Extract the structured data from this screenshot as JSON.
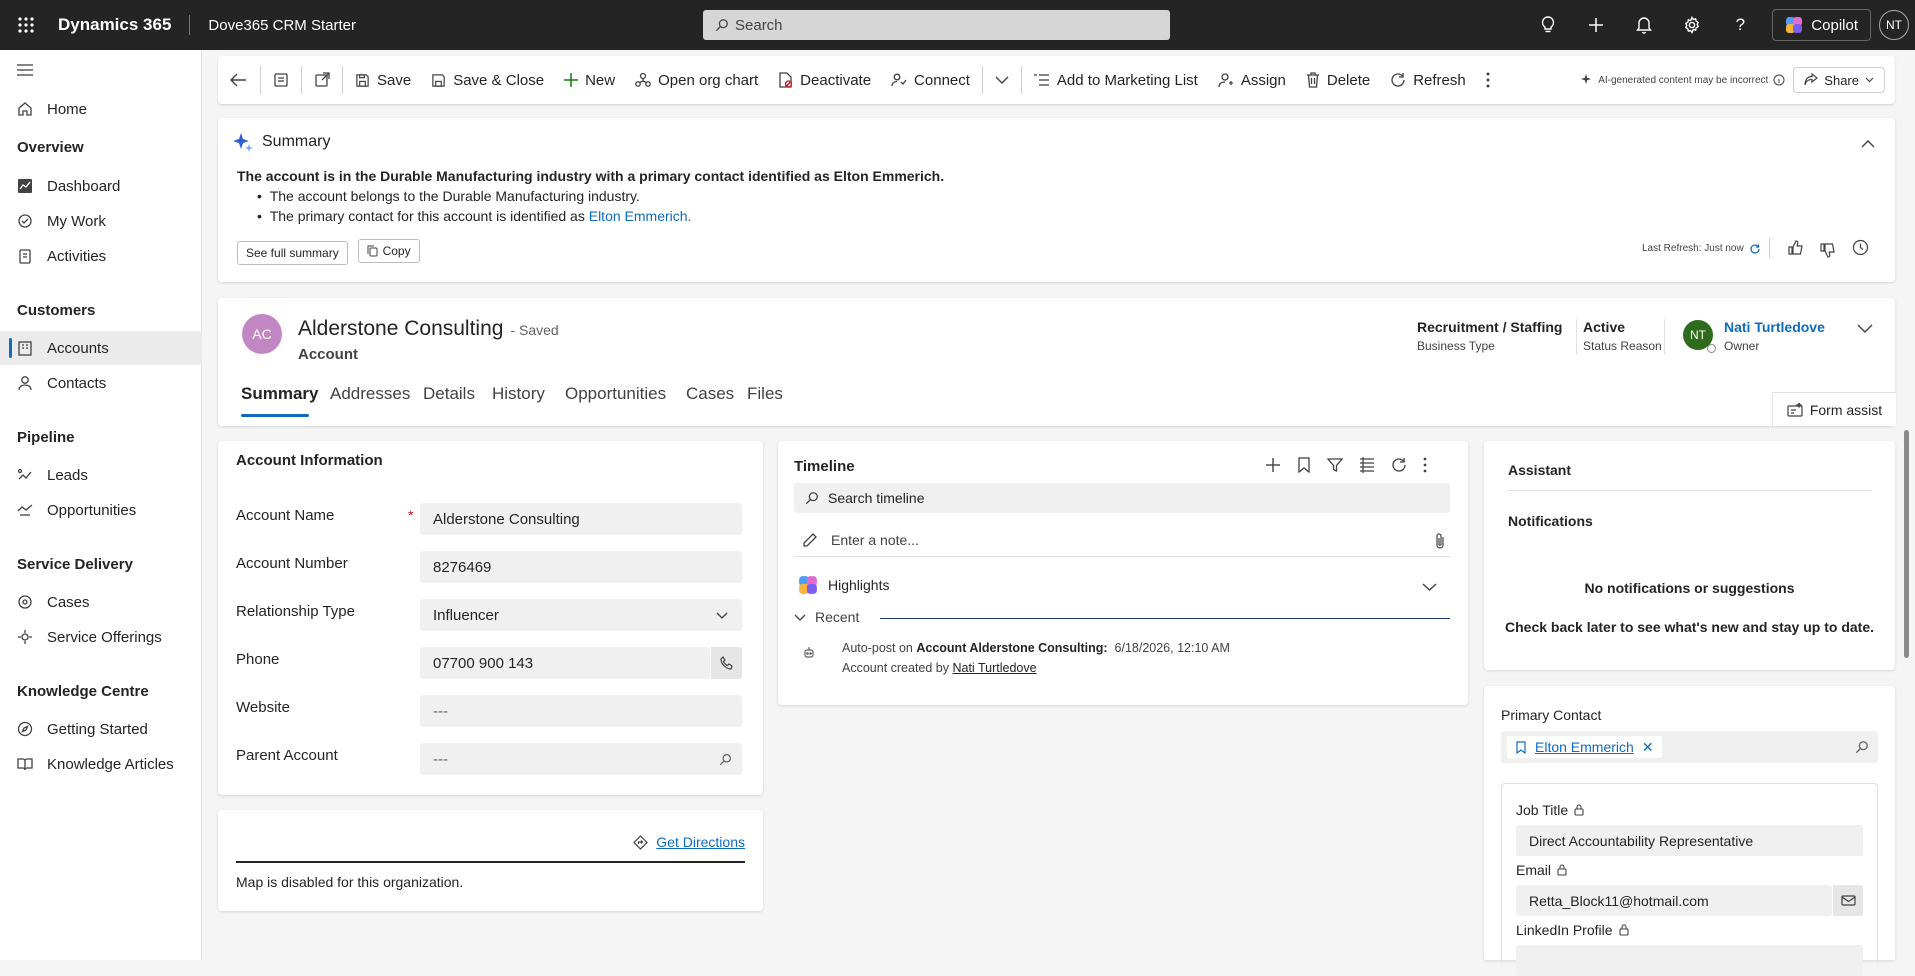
{
  "topbar": {
    "brand": "Dynamics 365",
    "app": "Dove365 CRM Starter",
    "search_placeholder": "Search",
    "copilot": "Copilot",
    "user_initials": "NT"
  },
  "sidebar": {
    "home": "Home",
    "sections": [
      {
        "title": "Overview",
        "items": [
          "Dashboard",
          "My Work",
          "Activities"
        ]
      },
      {
        "title": "Customers",
        "items": [
          "Accounts",
          "Contacts"
        ]
      },
      {
        "title": "Pipeline",
        "items": [
          "Leads",
          "Opportunities"
        ]
      },
      {
        "title": "Service Delivery",
        "items": [
          "Cases",
          "Service Offerings"
        ]
      },
      {
        "title": "Knowledge Centre",
        "items": [
          "Getting Started",
          "Knowledge Articles"
        ]
      }
    ]
  },
  "commands": {
    "save": "Save",
    "save_close": "Save & Close",
    "new": "New",
    "org_chart": "Open org chart",
    "deactivate": "Deactivate",
    "connect": "Connect",
    "marketing": "Add to Marketing List",
    "assign": "Assign",
    "delete": "Delete",
    "refresh": "Refresh",
    "ai_note": "AI-generated content may be incorrect",
    "share": "Share"
  },
  "summary": {
    "title": "Summary",
    "headline": "The account is in the Durable Manufacturing industry with a primary contact identified as Elton Emmerich.",
    "bullet1": "The account belongs to the Durable Manufacturing industry.",
    "bullet2_prefix": "The primary contact for this account is identified as ",
    "bullet2_link": "Elton Emmerich.",
    "see_full": "See full summary",
    "copy": "Copy",
    "last_refresh": "Last Refresh: Just now"
  },
  "record": {
    "initials": "AC",
    "name": "Alderstone Consulting",
    "saved": "- Saved",
    "entity": "Account",
    "business_type_value": "Recruitment / Staffing",
    "business_type_label": "Business Type",
    "status_value": "Active",
    "status_label": "Status Reason",
    "owner_initials": "NT",
    "owner_name": "Nati Turtledove",
    "owner_label": "Owner",
    "tabs": [
      "Summary",
      "Addresses",
      "Details",
      "History",
      "Opportunities",
      "Cases",
      "Files"
    ],
    "form_assist": "Form assist"
  },
  "account_info": {
    "title": "Account Information",
    "account_name_label": "Account Name",
    "required_mark": "*",
    "account_name": "Alderstone Consulting",
    "account_number_label": "Account Number",
    "account_number": "8276469",
    "relationship_label": "Relationship Type",
    "relationship": "Influencer",
    "phone_label": "Phone",
    "phone": "07700 900 143",
    "website_label": "Website",
    "website": "---",
    "parent_label": "Parent Account",
    "parent": "---"
  },
  "map": {
    "directions": "Get Directions",
    "disabled": "Map is disabled for this organization."
  },
  "timeline": {
    "title": "Timeline",
    "search_placeholder": "Search timeline",
    "note_placeholder": "Enter a note...",
    "highlights": "Highlights",
    "recent": "Recent",
    "post_prefix": "Auto-post on ",
    "post_bold": "Account Alderstone Consulting:",
    "post_date": "6/18/2026, 12:10 AM",
    "created_prefix": "Account created by ",
    "created_by": "Nati Turtledove"
  },
  "assistant": {
    "title": "Assistant",
    "notifications": "Notifications",
    "empty_title": "No notifications or suggestions",
    "empty_sub": "Check back later to see what's new and stay up to date."
  },
  "primary_contact": {
    "label": "Primary Contact",
    "name": "Elton Emmerich",
    "job_title_label": "Job Title",
    "job_title": "Direct Accountability Representative",
    "email_label": "Email",
    "email": "Retta_Block11@hotmail.com",
    "linkedin_label": "LinkedIn Profile"
  },
  "colors": {
    "accent": "#0f6cbd",
    "avatar_ac": "#c287c2",
    "avatar_owner": "#2e6b1d",
    "topbar": "#242424"
  }
}
